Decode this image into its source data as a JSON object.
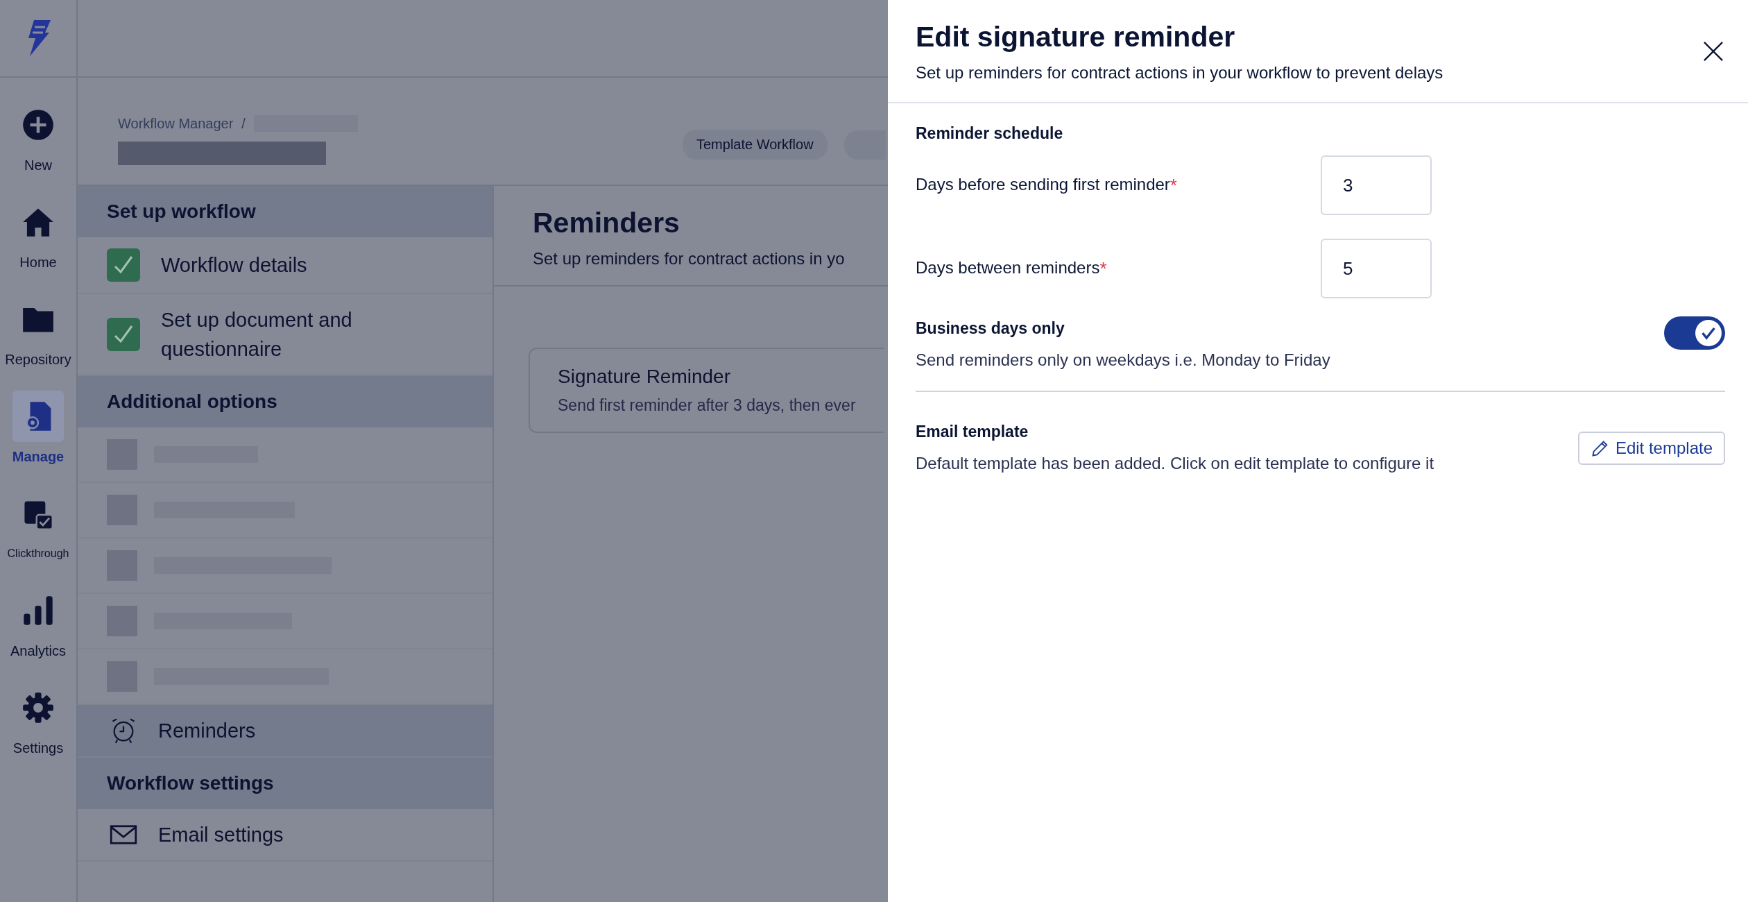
{
  "rail": {
    "items": [
      {
        "label": "New",
        "selected": false
      },
      {
        "label": "Home",
        "selected": false
      },
      {
        "label": "Repository",
        "selected": false
      },
      {
        "label": "Manage",
        "selected": true
      },
      {
        "label": "Clickthrough",
        "selected": false
      },
      {
        "label": "Analytics",
        "selected": false
      },
      {
        "label": "Settings",
        "selected": false
      }
    ]
  },
  "breadcrumb": {
    "items": [
      "Workflow Manager"
    ],
    "separator": "/"
  },
  "header": {
    "chip": "Template Workflow"
  },
  "steps_panel": {
    "sections": [
      {
        "title": "Set up workflow",
        "items": [
          {
            "kind": "step",
            "label": "Workflow details",
            "checked": true,
            "selected": false
          },
          {
            "kind": "step",
            "label": "Set up document and questionnaire",
            "checked": true,
            "selected": false
          }
        ]
      },
      {
        "title": "Additional options",
        "items": [
          {
            "kind": "redacted",
            "selected": false
          },
          {
            "kind": "redacted",
            "selected": false
          },
          {
            "kind": "redacted",
            "selected": false
          },
          {
            "kind": "redacted",
            "selected": false
          },
          {
            "kind": "redacted",
            "selected": false
          },
          {
            "kind": "page",
            "label": "Reminders",
            "selected": true
          }
        ]
      },
      {
        "title": "Workflow settings",
        "items": [
          {
            "kind": "page",
            "label": "Email settings",
            "selected": false
          }
        ]
      }
    ]
  },
  "main": {
    "title": "Reminders",
    "subtitle": "Set up reminders for contract actions in yo",
    "card": {
      "title": "Signature Reminder",
      "text": "Send first reminder after 3 days, then ever"
    }
  },
  "drawer": {
    "title": "Edit signature reminder",
    "subtitle": "Set up reminders for contract actions in your workflow to prevent delays",
    "schedule": {
      "title": "Reminder schedule",
      "fields": [
        {
          "label": "Days before sending first reminder",
          "mark": "*",
          "value": "3"
        },
        {
          "label": "Days between reminders",
          "mark": "*",
          "value": "5"
        }
      ]
    },
    "business_days": {
      "title": "Business days only",
      "description": "Send reminders only on weekdays i.e. Monday to Friday",
      "on": true
    },
    "email_template": {
      "title": "Email template",
      "description": "Default template has been added. Click on edit template to configure it",
      "button": "Edit template"
    }
  }
}
